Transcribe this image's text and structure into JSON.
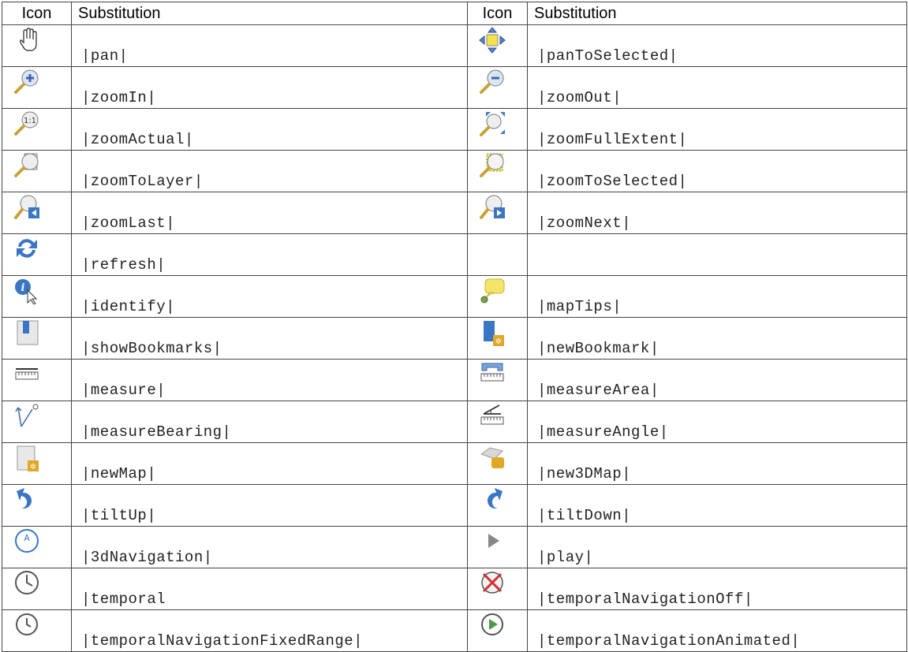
{
  "header": {
    "icon": "Icon",
    "substitution": "Substitution"
  },
  "rows": [
    {
      "left": {
        "icon": "pan-hand-icon",
        "text": "|pan|"
      },
      "right": {
        "icon": "pan-to-selected-icon",
        "text": "|panToSelected|"
      }
    },
    {
      "left": {
        "icon": "zoom-in-icon",
        "text": "|zoomIn|"
      },
      "right": {
        "icon": "zoom-out-icon",
        "text": "|zoomOut|"
      }
    },
    {
      "left": {
        "icon": "zoom-actual-icon",
        "text": "|zoomActual|"
      },
      "right": {
        "icon": "zoom-full-extent-icon",
        "text": "|zoomFullExtent|"
      }
    },
    {
      "left": {
        "icon": "zoom-to-layer-icon",
        "text": "|zoomToLayer|"
      },
      "right": {
        "icon": "zoom-to-selected-icon",
        "text": "|zoomToSelected|"
      }
    },
    {
      "left": {
        "icon": "zoom-last-icon",
        "text": "|zoomLast|"
      },
      "right": {
        "icon": "zoom-next-icon",
        "text": "|zoomNext|"
      }
    },
    {
      "left": {
        "icon": "refresh-icon",
        "text": "|refresh|"
      },
      "right": {
        "icon": "",
        "text": ""
      }
    },
    {
      "left": {
        "icon": "identify-icon",
        "text": "|identify|"
      },
      "right": {
        "icon": "map-tips-icon",
        "text": "|mapTips|"
      }
    },
    {
      "left": {
        "icon": "show-bookmarks-icon",
        "text": "|showBookmarks|"
      },
      "right": {
        "icon": "new-bookmark-icon",
        "text": "|newBookmark|"
      }
    },
    {
      "left": {
        "icon": "measure-icon",
        "text": "|measure|"
      },
      "right": {
        "icon": "measure-area-icon",
        "text": "|measureArea|"
      }
    },
    {
      "left": {
        "icon": "measure-bearing-icon",
        "text": "|measureBearing|"
      },
      "right": {
        "icon": "measure-angle-icon",
        "text": "|measureAngle|"
      }
    },
    {
      "left": {
        "icon": "new-map-icon",
        "text": "|newMap|"
      },
      "right": {
        "icon": "new-3d-map-icon",
        "text": "|new3DMap|"
      }
    },
    {
      "left": {
        "icon": "tilt-up-icon",
        "text": "|tiltUp|"
      },
      "right": {
        "icon": "tilt-down-icon",
        "text": "|tiltDown|"
      }
    },
    {
      "left": {
        "icon": "3d-navigation-icon",
        "text": "|3dNavigation|"
      },
      "right": {
        "icon": "play-icon",
        "text": "|play|"
      }
    },
    {
      "left": {
        "icon": "temporal-icon",
        "text": "|temporal"
      },
      "right": {
        "icon": "temporal-navigation-off-icon",
        "text": "|temporalNavigationOff|"
      }
    },
    {
      "left": {
        "icon": "temporal-fixed-range-icon",
        "text": "|temporalNavigationFixedRange|"
      },
      "right": {
        "icon": "temporal-animated-icon",
        "text": "|temporalNavigationAnimated|"
      }
    }
  ]
}
